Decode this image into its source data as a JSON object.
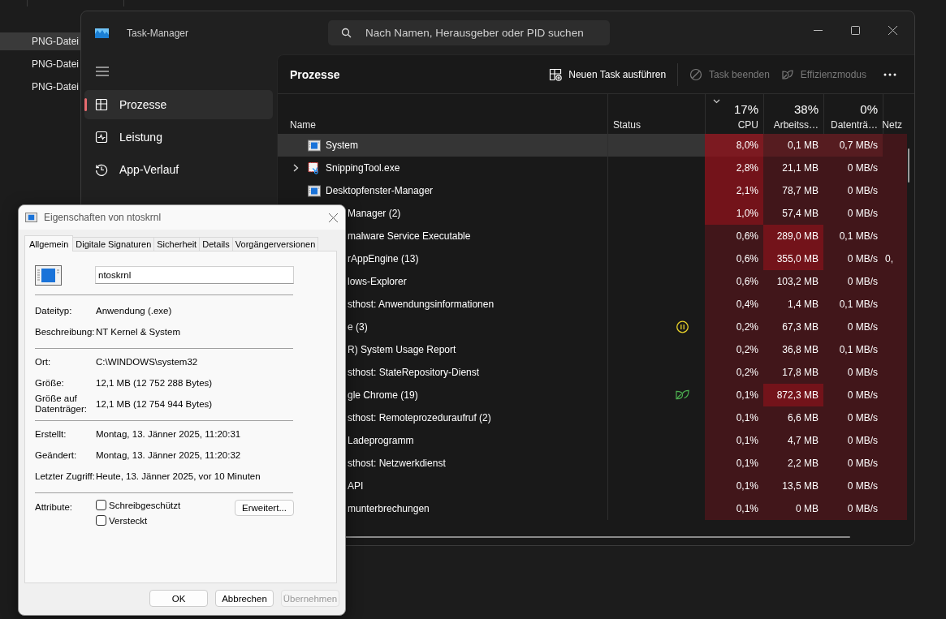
{
  "background_files": [
    {
      "type": "PNG-Datei",
      "selected": true
    },
    {
      "type": "PNG-Datei",
      "selected": false
    },
    {
      "type": "PNG-Datei",
      "selected": false
    }
  ],
  "task_manager": {
    "title": "Task-Manager",
    "search": {
      "placeholder": "Nach Namen, Herausgeber oder PID suchen"
    },
    "sidebar": {
      "items": [
        {
          "label": "Prozesse",
          "selected": true
        },
        {
          "label": "Leistung",
          "selected": false
        },
        {
          "label": "App-Verlauf",
          "selected": false
        }
      ]
    },
    "page_title": "Prozesse",
    "toolbar": [
      {
        "label": "Neuen Task ausführen",
        "disabled": false
      },
      {
        "label": "Task beenden",
        "disabled": true
      },
      {
        "label": "Effizienzmodus",
        "disabled": true
      }
    ],
    "columns": [
      {
        "name": "Name"
      },
      {
        "name": "Status"
      },
      {
        "name": "CPU",
        "total": "17%",
        "sorted": true
      },
      {
        "name": "Arbeitss…",
        "total": "38%",
        "sorted": false
      },
      {
        "name": "Datenträ…",
        "total": "0%",
        "sorted": false
      },
      {
        "name": "Netz"
      }
    ],
    "rows": [
      {
        "kind": "window",
        "name": "System",
        "expandable": false,
        "selected": true,
        "cpu": {
          "text": "8,0%",
          "color": "#7c1a21"
        },
        "memory": {
          "text": "0,1 MB",
          "color": "#561c20"
        },
        "disk": {
          "text": "0,7 MB/s",
          "color": "#561c20"
        }
      },
      {
        "kind": "scissors",
        "name": "SnippingTool.exe",
        "expandable": true,
        "selected": false,
        "cpu": {
          "text": "2,8%",
          "color": "#73131a"
        },
        "memory": {
          "text": "21,1 MB",
          "color": "#41161a"
        },
        "disk": {
          "text": "0 MB/s",
          "color": "#41161a"
        }
      },
      {
        "kind": "window",
        "name": "Desktopfenster-Manager",
        "expandable": false,
        "selected": false,
        "cpu": {
          "text": "2,1%",
          "color": "#73131a"
        },
        "memory": {
          "text": "78,7 MB",
          "color": "#41161a"
        },
        "disk": {
          "text": "0 MB/s",
          "color": "#41161a"
        }
      },
      {
        "kind": "covered",
        "name": "Manager (2)",
        "selected": false,
        "cpu": {
          "text": "1,0%",
          "color": "#73131a"
        },
        "memory": {
          "text": "57,4 MB",
          "color": "#41161a"
        },
        "disk": {
          "text": "0 MB/s",
          "color": "#41161a"
        }
      },
      {
        "kind": "covered",
        "name": "malware Service Executable",
        "selected": false,
        "cpu": {
          "text": "0,6%",
          "color": "#41161a"
        },
        "memory": {
          "text": "289,0 MB",
          "color": "#73131a"
        },
        "disk": {
          "text": "0,1 MB/s",
          "color": "#41161a"
        }
      },
      {
        "kind": "covered",
        "name": "rAppEngine (13)",
        "selected": false,
        "cpu": {
          "text": "0,6%",
          "color": "#41161a"
        },
        "memory": {
          "text": "355,0 MB",
          "color": "#73131a"
        },
        "disk": {
          "text": "0 MB/s",
          "color": "#41161a"
        },
        "network": "0,"
      },
      {
        "kind": "covered",
        "name": "lows-Explorer",
        "selected": false,
        "cpu": {
          "text": "0,6%",
          "color": "#41161a"
        },
        "memory": {
          "text": "103,2 MB",
          "color": "#41161a"
        },
        "disk": {
          "text": "0 MB/s",
          "color": "#41161a"
        }
      },
      {
        "kind": "covered",
        "name": "sthost: Anwendungsinformationen",
        "selected": false,
        "cpu": {
          "text": "0,4%",
          "color": "#41161a"
        },
        "memory": {
          "text": "1,4 MB",
          "color": "#41161a"
        },
        "disk": {
          "text": "0,1 MB/s",
          "color": "#41161a"
        }
      },
      {
        "kind": "covered",
        "name": "e (3)",
        "status": {
          "kind": "paused"
        },
        "selected": false,
        "cpu": {
          "text": "0,2%",
          "color": "#41161a"
        },
        "memory": {
          "text": "67,3 MB",
          "color": "#41161a"
        },
        "disk": {
          "text": "0 MB/s",
          "color": "#41161a"
        }
      },
      {
        "kind": "covered",
        "name": "R) System Usage Report",
        "selected": false,
        "cpu": {
          "text": "0,2%",
          "color": "#41161a"
        },
        "memory": {
          "text": "36,8 MB",
          "color": "#41161a"
        },
        "disk": {
          "text": "0,1 MB/s",
          "color": "#41161a"
        }
      },
      {
        "kind": "covered",
        "name": "sthost: StateRepository-Dienst",
        "selected": false,
        "cpu": {
          "text": "0,2%",
          "color": "#41161a"
        },
        "memory": {
          "text": "17,8 MB",
          "color": "#41161a"
        },
        "disk": {
          "text": "0 MB/s",
          "color": "#41161a"
        }
      },
      {
        "kind": "covered",
        "name": "gle Chrome (19)",
        "status": {
          "kind": "efficiency"
        },
        "selected": false,
        "cpu": {
          "text": "0,1%",
          "color": "#41161a"
        },
        "memory": {
          "text": "872,3 MB",
          "color": "#73131a"
        },
        "disk": {
          "text": "0 MB/s",
          "color": "#41161a"
        }
      },
      {
        "kind": "covered",
        "name": "sthost: Remoteprozeduraufruf (2)",
        "selected": false,
        "cpu": {
          "text": "0,1%",
          "color": "#41161a"
        },
        "memory": {
          "text": "6,6 MB",
          "color": "#41161a"
        },
        "disk": {
          "text": "0 MB/s",
          "color": "#41161a"
        }
      },
      {
        "kind": "covered",
        "name": "Ladeprogramm",
        "selected": false,
        "cpu": {
          "text": "0,1%",
          "color": "#41161a"
        },
        "memory": {
          "text": "4,7 MB",
          "color": "#41161a"
        },
        "disk": {
          "text": "0 MB/s",
          "color": "#41161a"
        }
      },
      {
        "kind": "covered",
        "name": "sthost: Netzwerkdienst",
        "selected": false,
        "cpu": {
          "text": "0,1%",
          "color": "#41161a"
        },
        "memory": {
          "text": "2,2 MB",
          "color": "#41161a"
        },
        "disk": {
          "text": "0 MB/s",
          "color": "#41161a"
        }
      },
      {
        "kind": "covered",
        "name": "API",
        "selected": false,
        "cpu": {
          "text": "0,1%",
          "color": "#41161a"
        },
        "memory": {
          "text": "13,5 MB",
          "color": "#41161a"
        },
        "disk": {
          "text": "0 MB/s",
          "color": "#41161a"
        }
      },
      {
        "kind": "covered",
        "name": "munterbrechungen",
        "selected": false,
        "cpu": {
          "text": "0,1%",
          "color": "#41161a"
        },
        "memory": {
          "text": "0 MB",
          "color": "#41161a"
        },
        "disk": {
          "text": "0 MB/s",
          "color": "#41161a"
        }
      }
    ]
  },
  "dialog": {
    "title": "Eigenschaften von ntoskrnl",
    "tabs": [
      {
        "label": "Allgemein",
        "selected": true
      },
      {
        "label": "Digitale Signaturen",
        "selected": false
      },
      {
        "label": "Sicherheit",
        "selected": false
      },
      {
        "label": "Details",
        "selected": false
      },
      {
        "label": "Vorgängerversionen",
        "selected": false
      }
    ],
    "file_name": "ntoskrnl",
    "sections": [
      [
        {
          "label": "Dateityp:",
          "value": "Anwendung (.exe)"
        },
        {
          "label": "Beschreibung:",
          "value": "NT Kernel & System"
        }
      ],
      [
        {
          "label": "Ort:",
          "value": "C:\\WINDOWS\\system32"
        },
        {
          "label": "Größe:",
          "value": "12,1 MB (12 752 288 Bytes)"
        },
        {
          "label": "Größe auf Datenträger:",
          "value": "12,1 MB (12 754 944 Bytes)"
        }
      ],
      [
        {
          "label": "Erstellt:",
          "value": "Montag, 13. Jänner 2025, 11:20:31"
        },
        {
          "label": "Geändert:",
          "value": "Montag, 13. Jänner 2025, 11:20:32"
        },
        {
          "label": "Letzter Zugriff:",
          "value": "Heute, 13. Jänner 2025, vor 10 Minuten"
        }
      ]
    ],
    "attributes": {
      "label": "Attribute:",
      "checkboxes": [
        {
          "label": "Schreibgeschützt",
          "checked": false
        },
        {
          "label": "Versteckt",
          "checked": false
        }
      ],
      "advanced_button": "Erweitert..."
    },
    "buttons": [
      {
        "label": "OK",
        "disabled": false
      },
      {
        "label": "Abbrechen",
        "disabled": false
      },
      {
        "label": "Übernehmen",
        "disabled": true
      }
    ]
  }
}
